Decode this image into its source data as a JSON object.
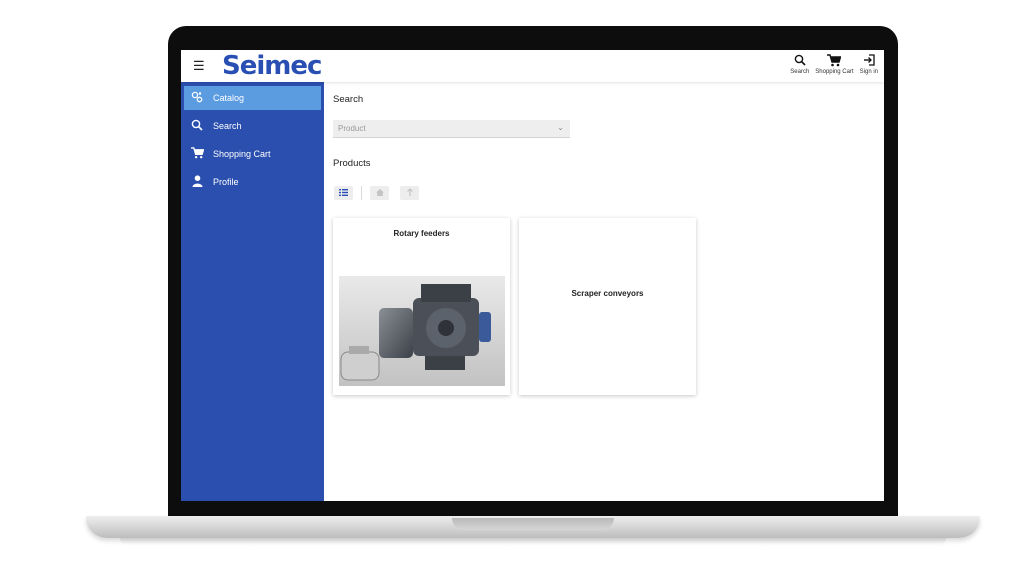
{
  "header": {
    "logo": "Seimec",
    "menu_icon": "hamburger-icon",
    "actions": [
      {
        "label": "Search",
        "icon": "search-icon"
      },
      {
        "label": "Shopping Cart",
        "icon": "cart-icon"
      },
      {
        "label": "Sign in",
        "icon": "sign-in-icon"
      }
    ]
  },
  "sidebar": {
    "items": [
      {
        "label": "Catalog",
        "icon": "catalog-icon",
        "active": true
      },
      {
        "label": "Search",
        "icon": "search-icon",
        "active": false
      },
      {
        "label": "Shopping Cart",
        "icon": "cart-icon",
        "active": false
      },
      {
        "label": "Profile",
        "icon": "profile-icon",
        "active": false
      }
    ]
  },
  "main": {
    "search_title": "Search",
    "filter": {
      "placeholder": "Product"
    },
    "products_title": "Products",
    "toolbar": [
      "list-view-icon",
      "home-icon",
      "up-arrow-icon"
    ],
    "products": [
      {
        "name": "Rotary feeders",
        "has_image": true
      },
      {
        "name": "Scraper conveyors",
        "has_image": false
      }
    ]
  },
  "colors": {
    "brand": "#2a4fb3",
    "sidebar": "#2a4fae",
    "sidebar_active": "#5b9be0"
  }
}
